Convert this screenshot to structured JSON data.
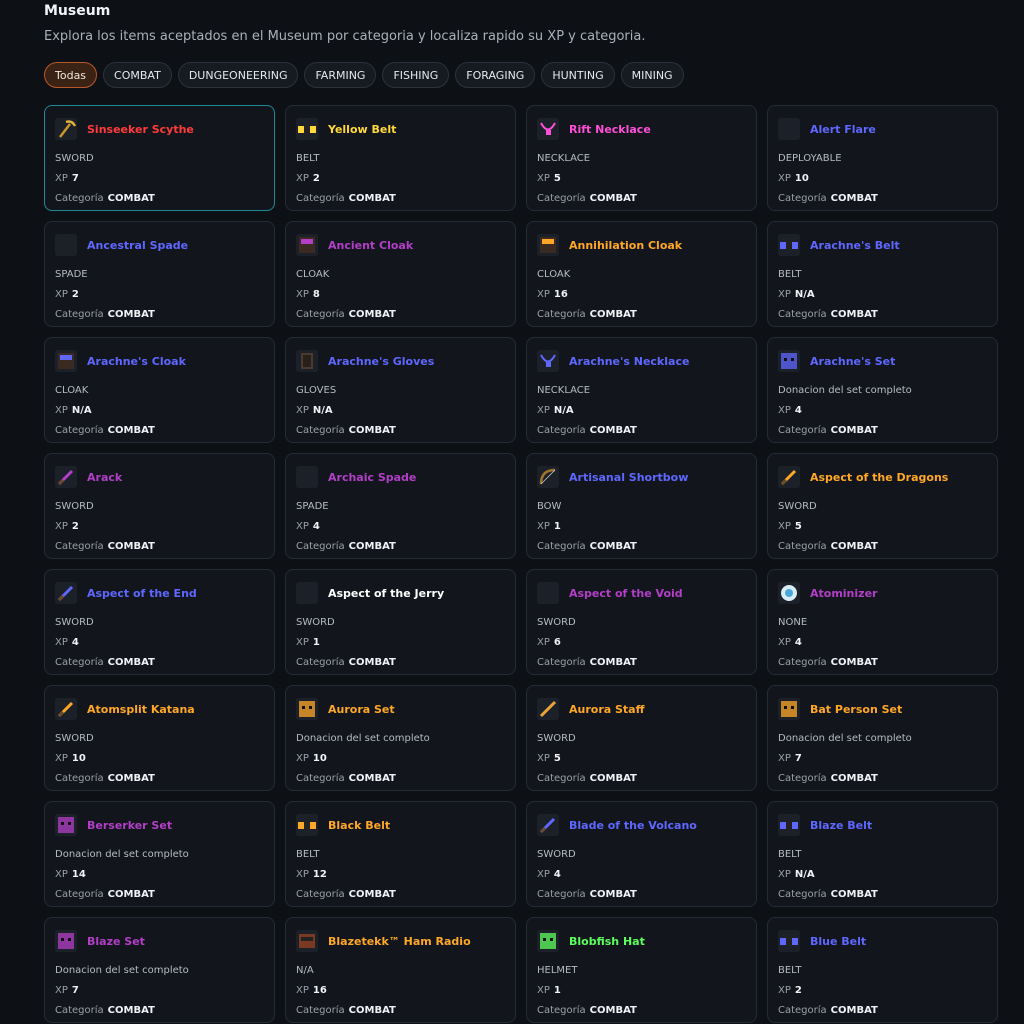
{
  "header": {
    "title": "Museum",
    "subtitle": "Explora los items aceptados en el Museum por categoria y localiza rapido su XP y categoria."
  },
  "filters": [
    "Todas",
    "COMBAT",
    "DUNGEONEERING",
    "FARMING",
    "FISHING",
    "FORAGING",
    "HUNTING",
    "MINING"
  ],
  "labels": {
    "xp": "XP",
    "category": "Categoría"
  },
  "colors": {
    "red": "#ff3b3b",
    "yellow": "#ffd83a",
    "pink": "#ff4fd8",
    "blue": "#5f67ff",
    "purple": "#b33ec8",
    "orange": "#ffa726",
    "white": "#ffffff",
    "green": "#5dff5d"
  },
  "items": [
    {
      "name": "Sinseeker Scythe",
      "type": "SWORD",
      "xp": "7",
      "category": "COMBAT",
      "color": "red",
      "icon": "scythe-icon"
    },
    {
      "name": "Yellow Belt",
      "type": "BELT",
      "xp": "2",
      "category": "COMBAT",
      "color": "yellow",
      "icon": "belt-icon"
    },
    {
      "name": "Rift Necklace",
      "type": "NECKLACE",
      "xp": "5",
      "category": "COMBAT",
      "color": "pink",
      "icon": "necklace-icon"
    },
    {
      "name": "Alert Flare",
      "type": "DEPLOYABLE",
      "xp": "10",
      "category": "COMBAT",
      "color": "blue",
      "icon": "empty-icon"
    },
    {
      "name": "Ancestral Spade",
      "type": "SPADE",
      "xp": "2",
      "category": "COMBAT",
      "color": "blue",
      "icon": "empty-icon"
    },
    {
      "name": "Ancient Cloak",
      "type": "CLOAK",
      "xp": "8",
      "category": "COMBAT",
      "color": "purple",
      "icon": "cloak-icon"
    },
    {
      "name": "Annihilation Cloak",
      "type": "CLOAK",
      "xp": "16",
      "category": "COMBAT",
      "color": "orange",
      "icon": "cloak-icon"
    },
    {
      "name": "Arachne's Belt",
      "type": "BELT",
      "xp": "N/A",
      "category": "COMBAT",
      "color": "blue",
      "icon": "belt-icon"
    },
    {
      "name": "Arachne's Cloak",
      "type": "CLOAK",
      "xp": "N/A",
      "category": "COMBAT",
      "color": "blue",
      "icon": "cloak-icon"
    },
    {
      "name": "Arachne's Gloves",
      "type": "GLOVES",
      "xp": "N/A",
      "category": "COMBAT",
      "color": "blue",
      "icon": "gloves-icon"
    },
    {
      "name": "Arachne's Necklace",
      "type": "NECKLACE",
      "xp": "N/A",
      "category": "COMBAT",
      "color": "blue",
      "icon": "necklace-icon"
    },
    {
      "name": "Arachne's Set",
      "type": "Donacion del set completo",
      "xp": "4",
      "category": "COMBAT",
      "color": "blue",
      "icon": "head-icon"
    },
    {
      "name": "Arack",
      "type": "SWORD",
      "xp": "2",
      "category": "COMBAT",
      "color": "purple",
      "icon": "sword-icon"
    },
    {
      "name": "Archaic Spade",
      "type": "SPADE",
      "xp": "4",
      "category": "COMBAT",
      "color": "purple",
      "icon": "empty-icon"
    },
    {
      "name": "Artisanal Shortbow",
      "type": "BOW",
      "xp": "1",
      "category": "COMBAT",
      "color": "blue",
      "icon": "bow-icon"
    },
    {
      "name": "Aspect of the Dragons",
      "type": "SWORD",
      "xp": "5",
      "category": "COMBAT",
      "color": "orange",
      "icon": "sword-icon"
    },
    {
      "name": "Aspect of the End",
      "type": "SWORD",
      "xp": "4",
      "category": "COMBAT",
      "color": "blue",
      "icon": "sword-icon"
    },
    {
      "name": "Aspect of the Jerry",
      "type": "SWORD",
      "xp": "1",
      "category": "COMBAT",
      "color": "white",
      "icon": "empty-icon"
    },
    {
      "name": "Aspect of the Void",
      "type": "SWORD",
      "xp": "6",
      "category": "COMBAT",
      "color": "purple",
      "icon": "empty-icon"
    },
    {
      "name": "Atominizer",
      "type": "NONE",
      "xp": "4",
      "category": "COMBAT",
      "color": "purple",
      "icon": "atom-icon"
    },
    {
      "name": "Atomsplit Katana",
      "type": "SWORD",
      "xp": "10",
      "category": "COMBAT",
      "color": "orange",
      "icon": "sword-icon"
    },
    {
      "name": "Aurora Set",
      "type": "Donacion del set completo",
      "xp": "10",
      "category": "COMBAT",
      "color": "orange",
      "icon": "head-icon"
    },
    {
      "name": "Aurora Staff",
      "type": "SWORD",
      "xp": "5",
      "category": "COMBAT",
      "color": "orange",
      "icon": "staff-icon"
    },
    {
      "name": "Bat Person Set",
      "type": "Donacion del set completo",
      "xp": "7",
      "category": "COMBAT",
      "color": "orange",
      "icon": "head-icon"
    },
    {
      "name": "Berserker Set",
      "type": "Donacion del set completo",
      "xp": "14",
      "category": "COMBAT",
      "color": "purple",
      "icon": "head-icon"
    },
    {
      "name": "Black Belt",
      "type": "BELT",
      "xp": "12",
      "category": "COMBAT",
      "color": "orange",
      "icon": "belt-icon"
    },
    {
      "name": "Blade of the Volcano",
      "type": "SWORD",
      "xp": "4",
      "category": "COMBAT",
      "color": "blue",
      "icon": "sword-icon"
    },
    {
      "name": "Blaze Belt",
      "type": "BELT",
      "xp": "N/A",
      "category": "COMBAT",
      "color": "blue",
      "icon": "belt-icon"
    },
    {
      "name": "Blaze Set",
      "type": "Donacion del set completo",
      "xp": "7",
      "category": "COMBAT",
      "color": "purple",
      "icon": "head-icon"
    },
    {
      "name": "Blazetekk™ Ham Radio",
      "type": "N/A",
      "xp": "16",
      "category": "COMBAT",
      "color": "orange",
      "icon": "radio-icon"
    },
    {
      "name": "Blobfish Hat",
      "type": "HELMET",
      "xp": "1",
      "category": "COMBAT",
      "color": "green",
      "icon": "head-icon"
    },
    {
      "name": "Blue Belt",
      "type": "BELT",
      "xp": "2",
      "category": "COMBAT",
      "color": "blue",
      "icon": "belt-icon"
    }
  ]
}
